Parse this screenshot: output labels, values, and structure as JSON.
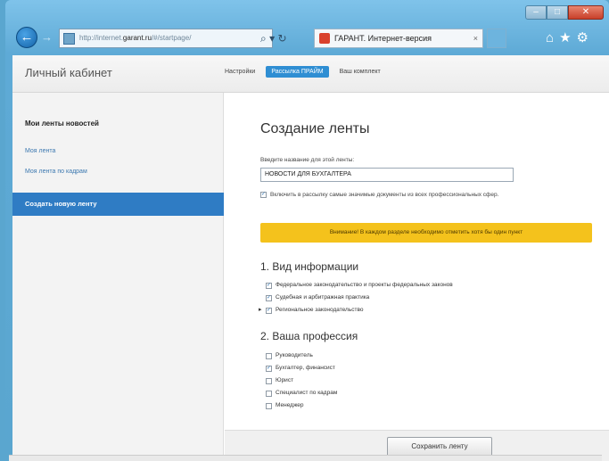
{
  "browser": {
    "address_prefix": "http://internet.",
    "address_domain": "garant.ru",
    "address_suffix": "/#/startpage/",
    "tab_title": "ГАРАНТ. Интернет-версия",
    "tab_close": "×"
  },
  "site": {
    "title": "Личный кабинет",
    "nav": [
      "Настройки",
      "Рассылка ПРАЙМ",
      "Ваш комплект"
    ]
  },
  "sidebar": {
    "title": "Мои ленты новостей",
    "links": [
      "Моя лента",
      "Моя лента по кадрам"
    ],
    "active": "Создать новую ленту"
  },
  "form": {
    "heading": "Создание ленты",
    "name_label": "Введите название для этой ленты:",
    "name_value": "НОВОСТИ ДЛЯ БУХГАЛТЕРА",
    "include_label": "Включить в рассылку самые значимые документы из всех профессиональных сфер.",
    "warning": "Внимание! В каждом разделе необходимо отметить хотя бы один пункт",
    "section1_title": "1. Вид информации",
    "info_options": [
      "Федеральное законодательство и проекты федеральных законов",
      "Судебная и арбитражная практика",
      "Региональное законодательство"
    ],
    "section2_title": "2. Ваша профессия",
    "profession_options": [
      "Руководитель",
      "Бухгалтер, финансист",
      "Юрист",
      "Специалист по кадрам",
      "Менеджер"
    ],
    "save_label": "Сохранить ленту"
  }
}
